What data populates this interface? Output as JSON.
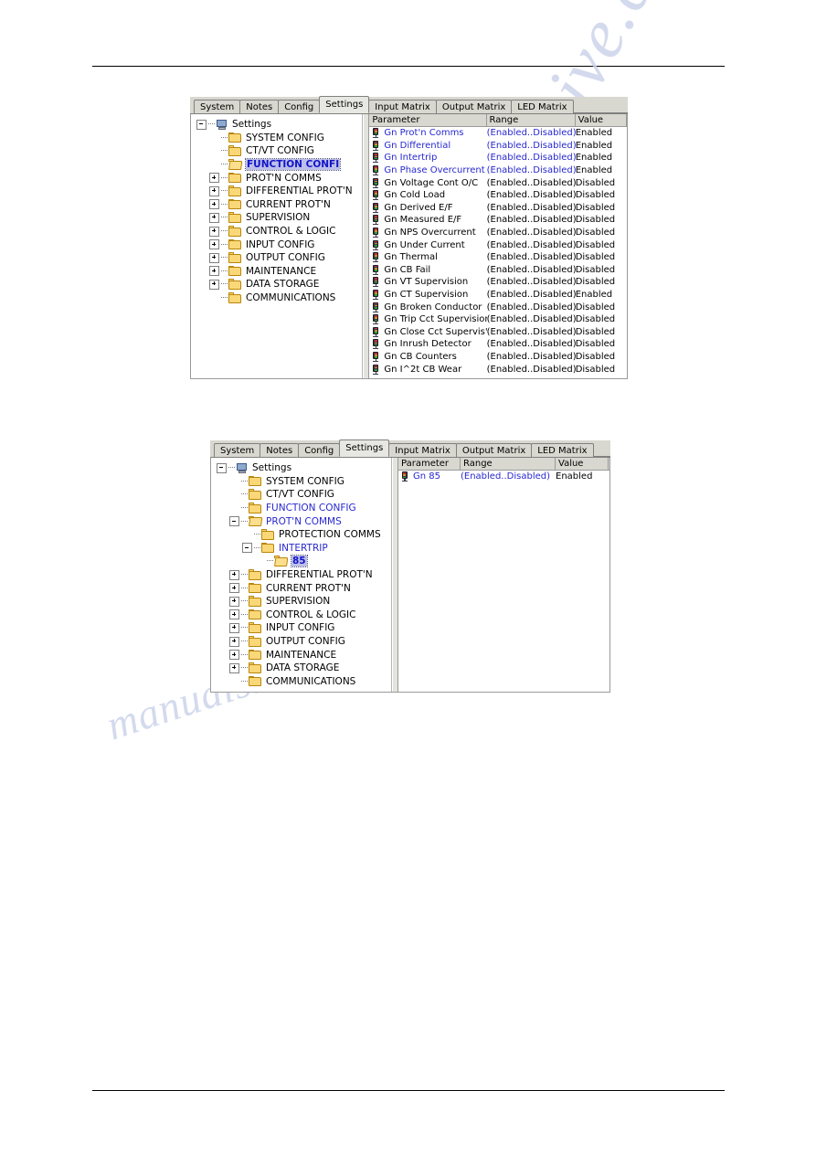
{
  "page": {
    "watermark_primary": "manualshive.com",
    "watermark_secondary": "manualshive.com"
  },
  "tabs": [
    "System",
    "Notes",
    "Config",
    "Settings",
    "Input Matrix",
    "Output Matrix",
    "LED Matrix"
  ],
  "active_tab": "Settings",
  "grid_columns": [
    "Parameter",
    "Range",
    "Value"
  ],
  "screenshot_1": {
    "tree": [
      {
        "label": "Settings",
        "depth": 0,
        "icon": "computer-icon",
        "expander": "minus",
        "state": "normal"
      },
      {
        "label": "SYSTEM CONFIG",
        "depth": 1,
        "icon": "folder-icon",
        "expander": "none",
        "state": "normal"
      },
      {
        "label": "CT/VT CONFIG",
        "depth": 1,
        "icon": "folder-icon",
        "expander": "none",
        "state": "normal"
      },
      {
        "label": "FUNCTION CONFI",
        "depth": 1,
        "icon": "folder-open-icon",
        "expander": "none",
        "state": "selected"
      },
      {
        "label": "PROT'N COMMS",
        "depth": 1,
        "icon": "folder-icon",
        "expander": "plus",
        "state": "normal"
      },
      {
        "label": "DIFFERENTIAL PROT'N",
        "depth": 1,
        "icon": "folder-icon",
        "expander": "plus",
        "state": "normal"
      },
      {
        "label": "CURRENT PROT'N",
        "depth": 1,
        "icon": "folder-icon",
        "expander": "plus",
        "state": "normal"
      },
      {
        "label": "SUPERVISION",
        "depth": 1,
        "icon": "folder-icon",
        "expander": "plus",
        "state": "normal"
      },
      {
        "label": "CONTROL & LOGIC",
        "depth": 1,
        "icon": "folder-icon",
        "expander": "plus",
        "state": "normal"
      },
      {
        "label": "INPUT CONFIG",
        "depth": 1,
        "icon": "folder-icon",
        "expander": "plus",
        "state": "normal"
      },
      {
        "label": "OUTPUT CONFIG",
        "depth": 1,
        "icon": "folder-icon",
        "expander": "plus",
        "state": "normal"
      },
      {
        "label": "MAINTENANCE",
        "depth": 1,
        "icon": "folder-icon",
        "expander": "plus",
        "state": "normal"
      },
      {
        "label": "DATA STORAGE",
        "depth": 1,
        "icon": "folder-icon",
        "expander": "plus",
        "state": "normal"
      },
      {
        "label": "COMMUNICATIONS",
        "depth": 1,
        "icon": "folder-icon",
        "expander": "none",
        "state": "normal"
      }
    ],
    "rows": [
      {
        "parameter": "Gn Prot'n Comms",
        "range": "(Enabled..Disabled)",
        "value": "Enabled",
        "highlight": true
      },
      {
        "parameter": "Gn Differential",
        "range": "(Enabled..Disabled)",
        "value": "Enabled",
        "highlight": true
      },
      {
        "parameter": "Gn Intertrip",
        "range": "(Enabled..Disabled)",
        "value": "Enabled",
        "highlight": true
      },
      {
        "parameter": "Gn Phase Overcurrent",
        "range": "(Enabled..Disabled)",
        "value": "Enabled",
        "highlight": true
      },
      {
        "parameter": "Gn Voltage Cont O/C",
        "range": "(Enabled..Disabled)",
        "value": "Disabled",
        "highlight": false
      },
      {
        "parameter": "Gn Cold Load",
        "range": "(Enabled..Disabled)",
        "value": "Disabled",
        "highlight": false
      },
      {
        "parameter": "Gn Derived E/F",
        "range": "(Enabled..Disabled)",
        "value": "Disabled",
        "highlight": false
      },
      {
        "parameter": "Gn Measured E/F",
        "range": "(Enabled..Disabled)",
        "value": "Disabled",
        "highlight": false
      },
      {
        "parameter": "Gn NPS Overcurrent",
        "range": "(Enabled..Disabled)",
        "value": "Disabled",
        "highlight": false
      },
      {
        "parameter": "Gn Under Current",
        "range": "(Enabled..Disabled)",
        "value": "Disabled",
        "highlight": false
      },
      {
        "parameter": "Gn Thermal",
        "range": "(Enabled..Disabled)",
        "value": "Disabled",
        "highlight": false
      },
      {
        "parameter": "Gn CB Fail",
        "range": "(Enabled..Disabled)",
        "value": "Disabled",
        "highlight": false
      },
      {
        "parameter": "Gn VT Supervision",
        "range": "(Enabled..Disabled)",
        "value": "Disabled",
        "highlight": false
      },
      {
        "parameter": "Gn CT Supervision",
        "range": "(Enabled..Disabled)",
        "value": "Enabled",
        "highlight": false
      },
      {
        "parameter": "Gn Broken Conductor",
        "range": "(Enabled..Disabled)",
        "value": "Disabled",
        "highlight": false
      },
      {
        "parameter": "Gn Trip Cct Supervision",
        "range": "(Enabled..Disabled)",
        "value": "Disabled",
        "highlight": false
      },
      {
        "parameter": "Gn Close Cct Supervis'n",
        "range": "(Enabled..Disabled)",
        "value": "Disabled",
        "highlight": false
      },
      {
        "parameter": "Gn Inrush Detector",
        "range": "(Enabled..Disabled)",
        "value": "Disabled",
        "highlight": false
      },
      {
        "parameter": "Gn CB Counters",
        "range": "(Enabled..Disabled)",
        "value": "Disabled",
        "highlight": false
      },
      {
        "parameter": "Gn I^2t CB Wear",
        "range": "(Enabled..Disabled)",
        "value": "Disabled",
        "highlight": false
      }
    ]
  },
  "screenshot_2": {
    "tree": [
      {
        "label": "Settings",
        "depth": 0,
        "icon": "computer-icon",
        "expander": "minus",
        "state": "normal"
      },
      {
        "label": "SYSTEM CONFIG",
        "depth": 1,
        "icon": "folder-icon",
        "expander": "none",
        "state": "normal"
      },
      {
        "label": "CT/VT CONFIG",
        "depth": 1,
        "icon": "folder-icon",
        "expander": "none",
        "state": "normal"
      },
      {
        "label": "FUNCTION CONFIG",
        "depth": 1,
        "icon": "folder-icon",
        "expander": "none",
        "state": "blue"
      },
      {
        "label": "PROT'N COMMS",
        "depth": 1,
        "icon": "folder-open-icon",
        "expander": "minus",
        "state": "blue"
      },
      {
        "label": "PROTECTION COMMS",
        "depth": 2,
        "icon": "folder-icon",
        "expander": "none",
        "state": "normal"
      },
      {
        "label": "INTERTRIP",
        "depth": 2,
        "icon": "folder-icon",
        "expander": "minus",
        "state": "blue"
      },
      {
        "label": "85",
        "depth": 3,
        "icon": "folder-open-icon",
        "expander": "none",
        "state": "selected"
      },
      {
        "label": "DIFFERENTIAL PROT'N",
        "depth": 1,
        "icon": "folder-icon",
        "expander": "plus",
        "state": "normal"
      },
      {
        "label": "CURRENT PROT'N",
        "depth": 1,
        "icon": "folder-icon",
        "expander": "plus",
        "state": "normal"
      },
      {
        "label": "SUPERVISION",
        "depth": 1,
        "icon": "folder-icon",
        "expander": "plus",
        "state": "normal"
      },
      {
        "label": "CONTROL & LOGIC",
        "depth": 1,
        "icon": "folder-icon",
        "expander": "plus",
        "state": "normal"
      },
      {
        "label": "INPUT CONFIG",
        "depth": 1,
        "icon": "folder-icon",
        "expander": "plus",
        "state": "normal"
      },
      {
        "label": "OUTPUT CONFIG",
        "depth": 1,
        "icon": "folder-icon",
        "expander": "plus",
        "state": "normal"
      },
      {
        "label": "MAINTENANCE",
        "depth": 1,
        "icon": "folder-icon",
        "expander": "plus",
        "state": "normal"
      },
      {
        "label": "DATA STORAGE",
        "depth": 1,
        "icon": "folder-icon",
        "expander": "plus",
        "state": "normal"
      },
      {
        "label": "COMMUNICATIONS",
        "depth": 1,
        "icon": "folder-icon",
        "expander": "none",
        "state": "normal"
      }
    ],
    "rows": [
      {
        "parameter": "Gn 85",
        "range": "(Enabled..Disabled)",
        "value": "Enabled",
        "highlight": true
      }
    ]
  }
}
